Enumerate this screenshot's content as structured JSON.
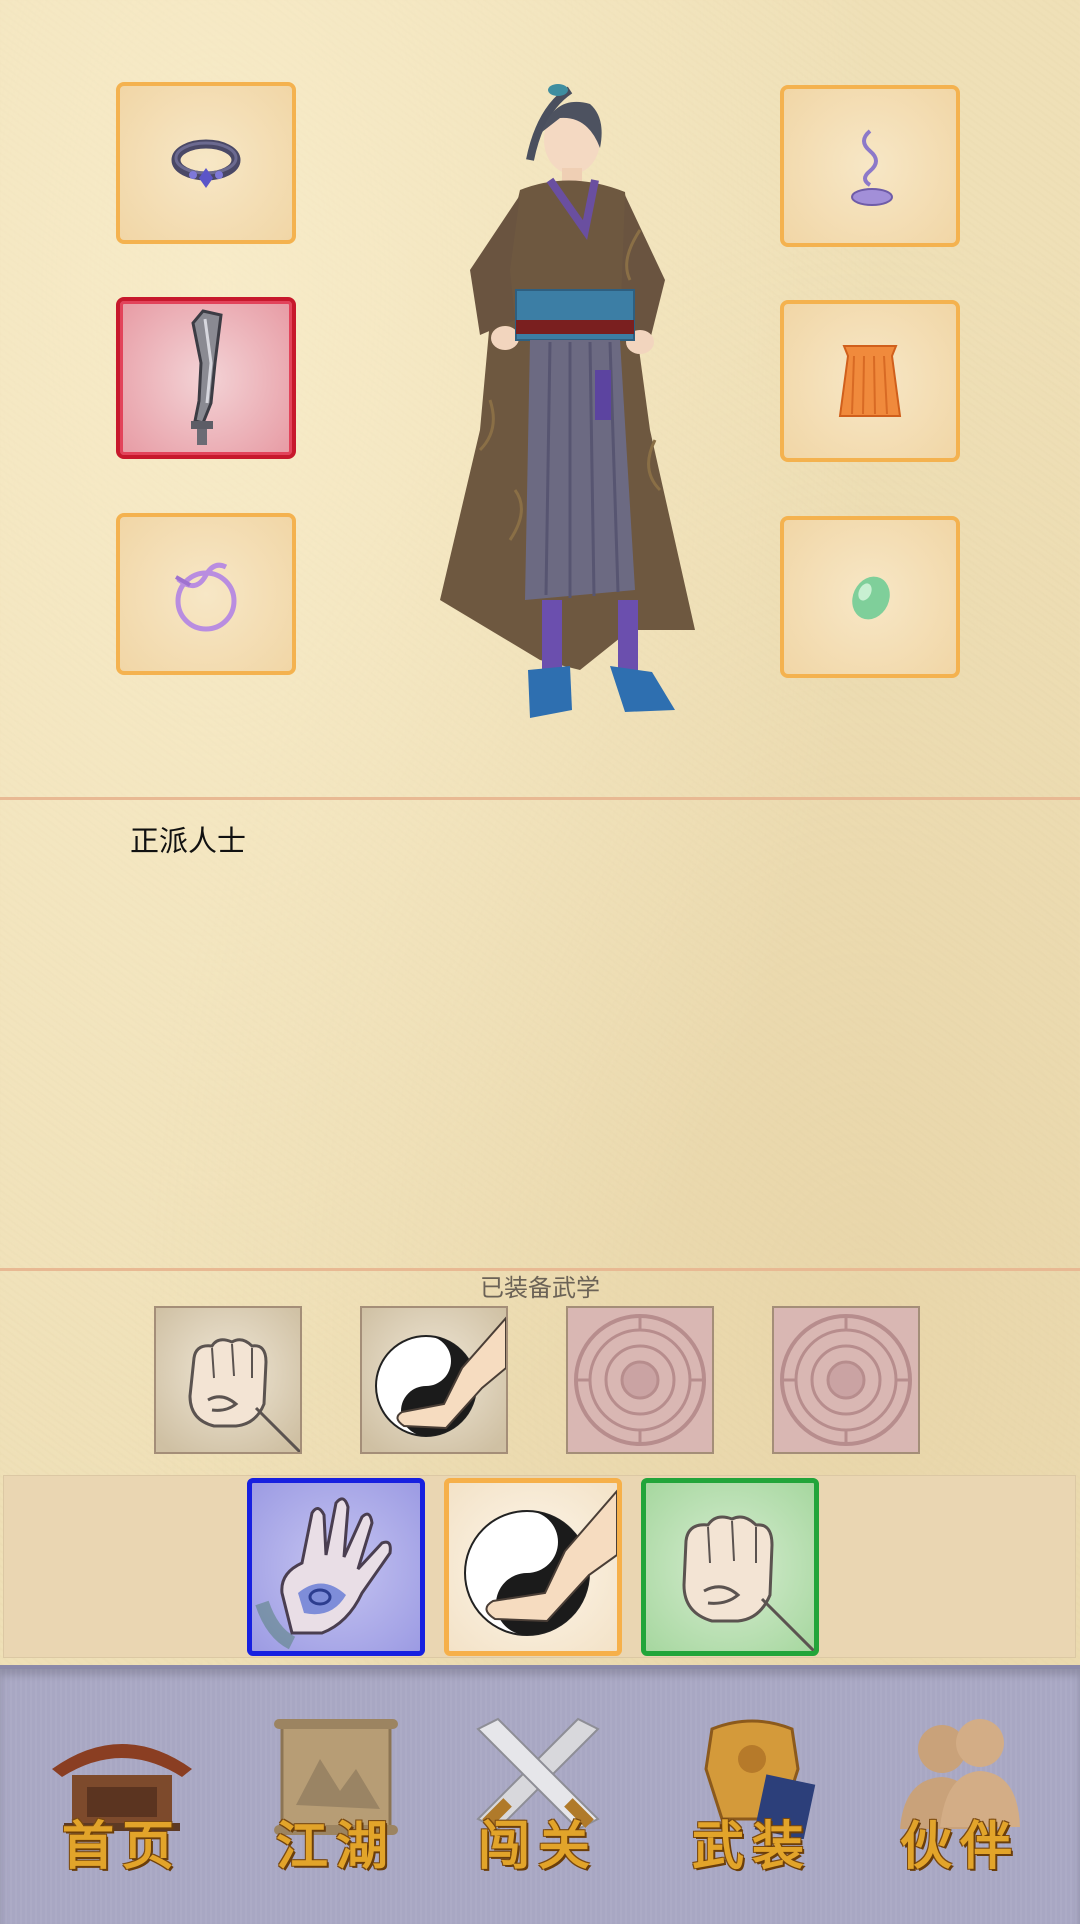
{
  "equipment": {
    "left_slots": [
      {
        "item": "bracelet",
        "icon": "bracelet-icon",
        "rarity": "common"
      },
      {
        "item": "sabre",
        "icon": "sabre-icon",
        "rarity": "red"
      },
      {
        "item": "ribbon ring",
        "icon": "ribbon-ring-icon",
        "rarity": "common"
      }
    ],
    "right_slots": [
      {
        "item": "incense",
        "icon": "incense-icon",
        "rarity": "common"
      },
      {
        "item": "robe",
        "icon": "robe-icon",
        "rarity": "common"
      },
      {
        "item": "jade",
        "icon": "jade-icon",
        "rarity": "common"
      }
    ]
  },
  "character": {
    "faction": "正派人士"
  },
  "martial_arts": {
    "title": "已装备武学",
    "equipped_slots": [
      {
        "icon": "fist-icon",
        "state": "filled"
      },
      {
        "icon": "yin-yang-palm-icon",
        "state": "filled"
      },
      {
        "icon": "empty-seal-icon",
        "state": "empty"
      },
      {
        "icon": "empty-seal-icon",
        "state": "empty"
      }
    ],
    "available": [
      {
        "icon": "open-palm-icon",
        "border_color": "#1720e0"
      },
      {
        "icon": "yin-yang-palm-icon",
        "border_color": "#f6b04a"
      },
      {
        "icon": "fist-icon",
        "border_color": "#22a53a"
      }
    ]
  },
  "bottom_nav": {
    "items": [
      {
        "label": "首页",
        "icon": "pavilion-icon"
      },
      {
        "label": "江湖",
        "icon": "scroll-map-icon"
      },
      {
        "label": "闯关",
        "icon": "crossed-swords-icon"
      },
      {
        "label": "武装",
        "icon": "armor-book-icon"
      },
      {
        "label": "伙伴",
        "icon": "companions-icon"
      }
    ]
  }
}
